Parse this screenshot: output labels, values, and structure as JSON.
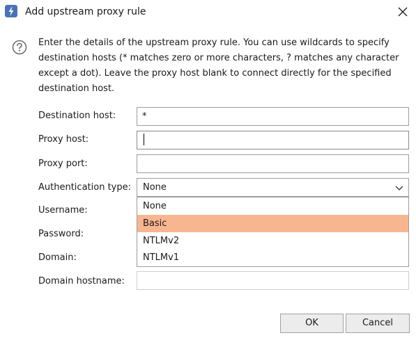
{
  "window": {
    "title": "Add upstream proxy rule",
    "close_icon": "close-icon",
    "app_icon": "lightning-bolt-icon",
    "accent_color": "#4a72b8"
  },
  "help": {
    "icon": "help-question-icon",
    "description": "Enter the details of the upstream proxy rule. You can use wildcards to specify destination hosts (* matches zero or more characters, ? matches any character except a dot). Leave the proxy host blank to connect directly for the specified destination host."
  },
  "form": {
    "destination_host": {
      "label": "Destination host:",
      "value": "*"
    },
    "proxy_host": {
      "label": "Proxy host:",
      "value": ""
    },
    "proxy_port": {
      "label": "Proxy port:",
      "value": ""
    },
    "authentication_type": {
      "label": "Authentication type:",
      "value": "None",
      "options": [
        "None",
        "Basic",
        "NTLMv2",
        "NTLMv1"
      ],
      "highlighted_option": "Basic",
      "highlight_color": "#f8b690"
    },
    "username": {
      "label": "Username:",
      "value": ""
    },
    "password": {
      "label": "Password:",
      "value": ""
    },
    "domain": {
      "label": "Domain:",
      "value": ""
    },
    "domain_hostname": {
      "label": "Domain hostname:",
      "value": ""
    }
  },
  "buttons": {
    "ok": "OK",
    "cancel": "Cancel"
  }
}
